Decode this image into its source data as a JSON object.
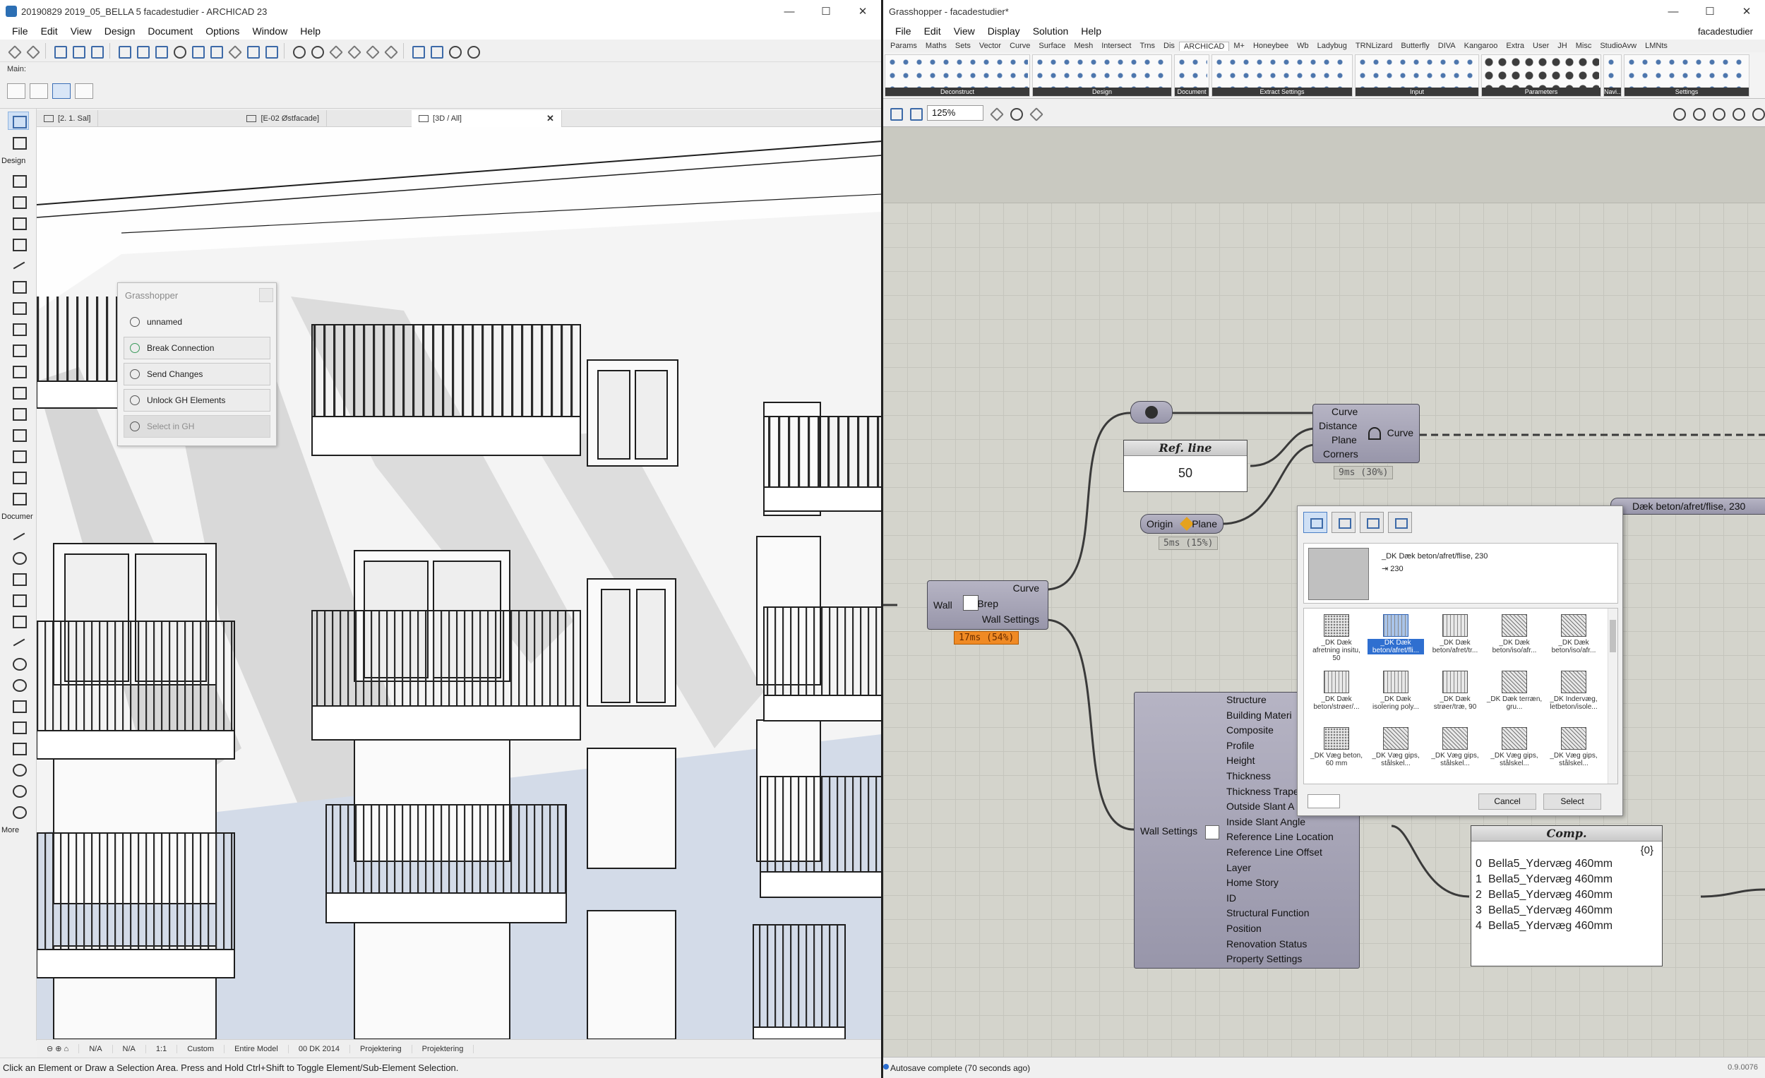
{
  "archicad": {
    "title": "20190829 2019_05_BELLA 5 facadestudier - ARCHICAD 23",
    "menu": [
      "File",
      "Edit",
      "View",
      "Design",
      "Document",
      "Options",
      "Window",
      "Help"
    ],
    "info_box_label": "Main:",
    "toolbox_sections": {
      "design": "Design",
      "document": "Documer",
      "more": "More"
    },
    "tabs": [
      {
        "label": "[2. 1. Sal]"
      },
      {
        "label": "[E-02 Østfacade]"
      },
      {
        "label": "[3D / All]"
      }
    ],
    "grasshopper_palette": {
      "title": "Grasshopper",
      "file": "unnamed",
      "break": "Break Connection",
      "send": "Send Changes",
      "unlock": "Unlock GH Elements",
      "select": "Select in GH"
    },
    "bottom_bar": [
      "N/A",
      "N/A",
      "1:1",
      "Custom",
      "Entire Model",
      "00 DK 2014",
      "Projektering",
      "Projektering"
    ],
    "status": "Click an Element or Draw a Selection Area. Press and Hold Ctrl+Shift to Toggle Element/Sub-Element Selection."
  },
  "grasshopper": {
    "title": "Grasshopper - facadestudier*",
    "doc_name": "facadestudier",
    "menu": [
      "File",
      "Edit",
      "View",
      "Display",
      "Solution",
      "Help"
    ],
    "tabs": [
      "Params",
      "Maths",
      "Sets",
      "Vector",
      "Curve",
      "Surface",
      "Mesh",
      "Intersect",
      "Trns",
      "Dis",
      "ARCHICAD",
      "M+",
      "Honeybee",
      "Wb",
      "Ladybug",
      "TRNLizard",
      "Butterfly",
      "DIVA",
      "Kangaroo",
      "Extra",
      "User",
      "JH",
      "Misc",
      "StudioAvw",
      "LMNts"
    ],
    "active_tab": "ARCHICAD",
    "ribbon_groups": [
      "Deconstruct",
      "Design",
      "Document",
      "Extract Settings",
      "Input",
      "Parameters",
      "Navi...",
      "Settings"
    ],
    "zoom": "125%",
    "status": "Autosave complete (70 seconds ago)",
    "version": "0.9.0076",
    "nodes": {
      "wall": {
        "label": "Wall",
        "outputs": [
          "Curve",
          "Brep",
          "Wall Settings"
        ],
        "timer": "17ms (54%)"
      },
      "ref_line": {
        "title": "Ref. line",
        "value": "50"
      },
      "plane": {
        "input": "Origin",
        "output": "Plane",
        "timer": "5ms (15%)"
      },
      "offset": {
        "inputs": [
          "Curve",
          "Distance",
          "Plane",
          "Corners"
        ],
        "output": "Curve",
        "timer": "9ms (30%)"
      },
      "wall_settings": {
        "input": "Wall Settings",
        "outputs": [
          "Structure",
          "Building Materi",
          "Composite",
          "Profile",
          "Height",
          "Thickness",
          "Thickness Trape",
          "Outside Slant A",
          "Inside Slant Angle",
          "Reference Line Location",
          "Reference Line Offset",
          "Layer",
          "Home Story",
          "ID",
          "Structural Function",
          "Position",
          "Renovation Status",
          "Property Settings"
        ]
      },
      "comp_panel": {
        "title": "Comp.",
        "path": "{0}",
        "rows": [
          {
            "i": "0",
            "v": "Bella5_Ydervæg 460mm"
          },
          {
            "i": "1",
            "v": "Bella5_Ydervæg 460mm"
          },
          {
            "i": "2",
            "v": "Bella5_Ydervæg 460mm"
          },
          {
            "i": "3",
            "v": "Bella5_Ydervæg 460mm"
          },
          {
            "i": "4",
            "v": "Bella5_Ydervæg 460mm"
          }
        ]
      },
      "material_value": "Dæk beton/afret/flise, 230"
    },
    "material_dialog": {
      "preview_name": "_DK Dæk beton/afret/flise, 230",
      "preview_thickness": "230",
      "tiles": [
        "_DK Dæk afretning insitu, 50",
        "_DK Dæk beton/afret/fli...",
        "_DK Dæk beton/afret/tr...",
        "_DK Dæk beton/iso/afr...",
        "_DK Dæk beton/iso/afr...",
        "_DK Dæk beton/strøer/...",
        "_DK Dæk isolering poly...",
        "_DK Dæk strøer/træ, 90",
        "_DK Dæk terræn, gru...",
        "_DK Indervæg, letbeton/isole...",
        "_DK Væg beton, 60 mm",
        "_DK Væg gips, stålskel...",
        "_DK Væg gips, stålskel...",
        "_DK Væg gips, stålskel...",
        "_DK Væg gips, stålskel..."
      ],
      "cancel": "Cancel",
      "select": "Select"
    }
  }
}
